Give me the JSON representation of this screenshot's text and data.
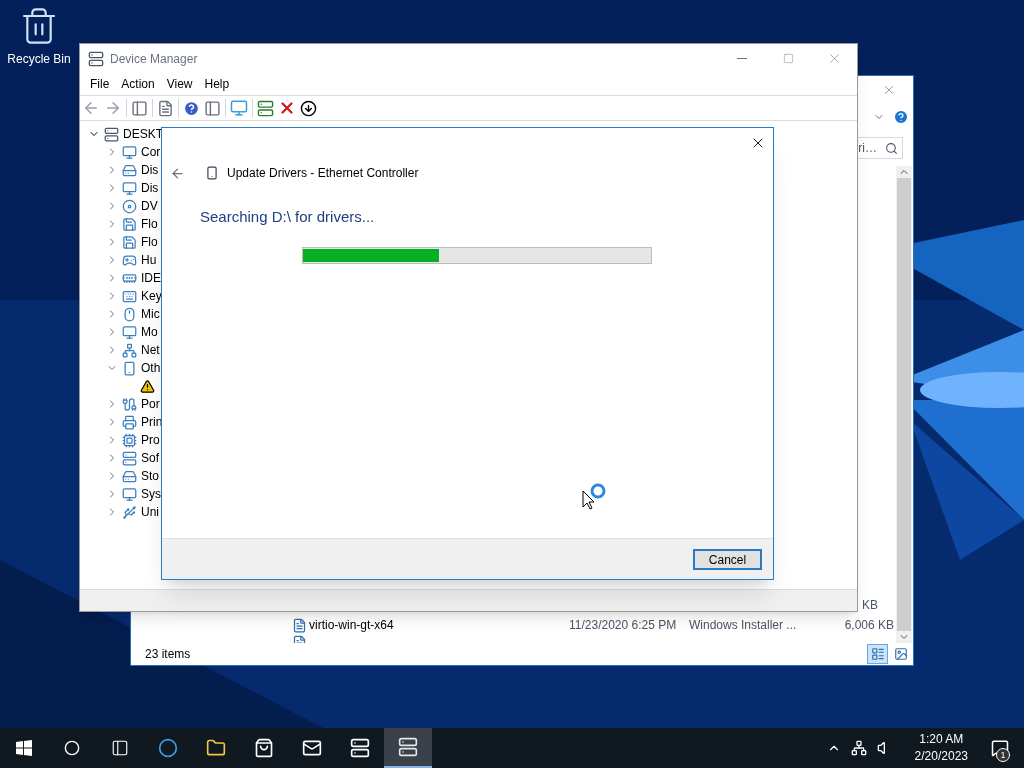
{
  "desktop_icons": [
    {
      "label": "Recycle Bin"
    }
  ],
  "explorer": {
    "search": {
      "value": "ri…"
    },
    "columns_partial": "KB",
    "rows": [
      {
        "name": "virtio-win-gt-x64",
        "date": "11/23/2020 6:25 PM",
        "type": "Windows Installer ...",
        "size": "6,006 KB"
      }
    ],
    "status": "23 items",
    "views": [
      {
        "selected": true
      },
      {
        "selected": false
      }
    ]
  },
  "device_manager": {
    "title": "Device Manager",
    "menu": [
      "File",
      "Action",
      "View",
      "Help"
    ],
    "tree": {
      "label": "DESKT",
      "expanded": true,
      "children": [
        {
          "label": "Cor",
          "expanded": false
        },
        {
          "label": "Dis",
          "expanded": false
        },
        {
          "label": "Dis",
          "expanded": false
        },
        {
          "label": "DV",
          "expanded": false
        },
        {
          "label": "Flo",
          "expanded": false
        },
        {
          "label": "Flo",
          "expanded": false
        },
        {
          "label": "Hu",
          "expanded": false
        },
        {
          "label": "IDE",
          "expanded": false
        },
        {
          "label": "Key",
          "expanded": false
        },
        {
          "label": "Mic",
          "expanded": false
        },
        {
          "label": "Mo",
          "expanded": false
        },
        {
          "label": "Net",
          "expanded": false
        },
        {
          "label": "Oth",
          "expanded": true,
          "children": [
            {
              "kind": "warning-device"
            }
          ]
        },
        {
          "label": "Por",
          "expanded": false
        },
        {
          "label": "Prin",
          "expanded": false
        },
        {
          "label": "Pro",
          "expanded": false
        },
        {
          "label": "Sof",
          "expanded": false
        },
        {
          "label": "Sto",
          "expanded": false
        },
        {
          "label": "Sys",
          "expanded": false
        },
        {
          "label": "Uni",
          "expanded": false
        }
      ]
    }
  },
  "dialog": {
    "title": "Update Drivers - Ethernet Controller",
    "status": "Searching D:\\ for drivers...",
    "level": 0.39,
    "cancel": "Cancel"
  },
  "taskbar": {
    "apps": [
      {
        "active": false
      },
      {
        "active": false
      },
      {
        "active": false
      },
      {
        "active": false
      },
      {
        "active": false
      },
      {
        "active": true
      }
    ],
    "time": "1:20 AM",
    "date": "2/20/2023",
    "notifications": "1"
  }
}
